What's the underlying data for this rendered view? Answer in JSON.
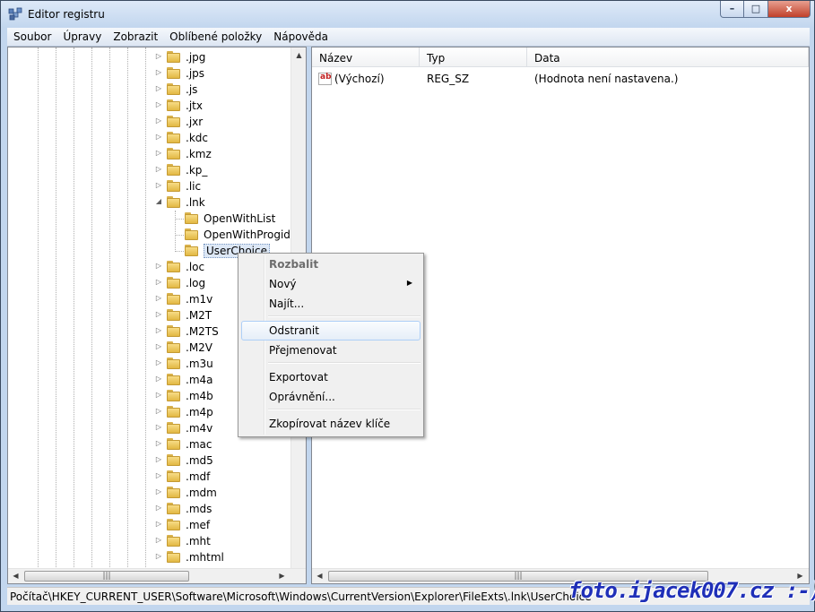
{
  "window": {
    "title": "Editor registru",
    "minimize_glyph": "–",
    "maximize_glyph": "□",
    "close_glyph": "x"
  },
  "menubar": [
    "Soubor",
    "Úpravy",
    "Zobrazit",
    "Oblíbené položky",
    "Nápověda"
  ],
  "tree": {
    "items": [
      {
        "label": ".jpg",
        "level": 1,
        "expander": "collapsed"
      },
      {
        "label": ".jps",
        "level": 1,
        "expander": "collapsed"
      },
      {
        "label": ".js",
        "level": 1,
        "expander": "collapsed"
      },
      {
        "label": ".jtx",
        "level": 1,
        "expander": "collapsed"
      },
      {
        "label": ".jxr",
        "level": 1,
        "expander": "collapsed"
      },
      {
        "label": ".kdc",
        "level": 1,
        "expander": "collapsed"
      },
      {
        "label": ".kmz",
        "level": 1,
        "expander": "collapsed"
      },
      {
        "label": ".kp_",
        "level": 1,
        "expander": "collapsed"
      },
      {
        "label": ".lic",
        "level": 1,
        "expander": "collapsed"
      },
      {
        "label": ".lnk",
        "level": 1,
        "expander": "expanded"
      },
      {
        "label": "OpenWithList",
        "level": 2,
        "expander": "none"
      },
      {
        "label": "OpenWithProgids",
        "level": 2,
        "expander": "none"
      },
      {
        "label": "UserChoice",
        "level": 2,
        "expander": "none",
        "selected": true
      },
      {
        "label": ".loc",
        "level": 1,
        "expander": "collapsed"
      },
      {
        "label": ".log",
        "level": 1,
        "expander": "collapsed"
      },
      {
        "label": ".m1v",
        "level": 1,
        "expander": "collapsed"
      },
      {
        "label": ".M2T",
        "level": 1,
        "expander": "collapsed"
      },
      {
        "label": ".M2TS",
        "level": 1,
        "expander": "collapsed"
      },
      {
        "label": ".M2V",
        "level": 1,
        "expander": "collapsed"
      },
      {
        "label": ".m3u",
        "level": 1,
        "expander": "collapsed"
      },
      {
        "label": ".m4a",
        "level": 1,
        "expander": "collapsed"
      },
      {
        "label": ".m4b",
        "level": 1,
        "expander": "collapsed"
      },
      {
        "label": ".m4p",
        "level": 1,
        "expander": "collapsed"
      },
      {
        "label": ".m4v",
        "level": 1,
        "expander": "collapsed"
      },
      {
        "label": ".mac",
        "level": 1,
        "expander": "collapsed"
      },
      {
        "label": ".md5",
        "level": 1,
        "expander": "collapsed"
      },
      {
        "label": ".mdf",
        "level": 1,
        "expander": "collapsed"
      },
      {
        "label": ".mdm",
        "level": 1,
        "expander": "collapsed"
      },
      {
        "label": ".mds",
        "level": 1,
        "expander": "collapsed"
      },
      {
        "label": ".mef",
        "level": 1,
        "expander": "collapsed"
      },
      {
        "label": ".mht",
        "level": 1,
        "expander": "collapsed"
      },
      {
        "label": ".mhtml",
        "level": 1,
        "expander": "collapsed"
      }
    ]
  },
  "list": {
    "columns": [
      "Název",
      "Typ",
      "Data"
    ],
    "rows": [
      {
        "icon": "string-value-icon",
        "icon_text": "ab",
        "name": "(Výchozí)",
        "type": "REG_SZ",
        "data": "(Hodnota není nastavena.)"
      }
    ]
  },
  "context_menu": {
    "items": [
      {
        "label": "Rozbalit",
        "disabled": true
      },
      {
        "label": "Nový",
        "submenu": true
      },
      {
        "label": "Najít..."
      },
      {
        "separator": true
      },
      {
        "label": "Odstranit",
        "hover": true
      },
      {
        "label": "Přejmenovat"
      },
      {
        "separator": true
      },
      {
        "label": "Exportovat"
      },
      {
        "label": "Oprávnění..."
      },
      {
        "separator": true
      },
      {
        "label": "Zkopírovat název klíče"
      }
    ]
  },
  "status": {
    "path": "Počítač\\HKEY_CURRENT_USER\\Software\\Microsoft\\Windows\\CurrentVersion\\Explorer\\FileExts\\.lnk\\UserChoice"
  },
  "watermark": "foto.ijacek007.cz :-)",
  "colors": {
    "folder": "#e2b843",
    "selection": "#dde8f6",
    "menu_hover_border": "#aecff7",
    "watermark": "#1f2fb8"
  }
}
